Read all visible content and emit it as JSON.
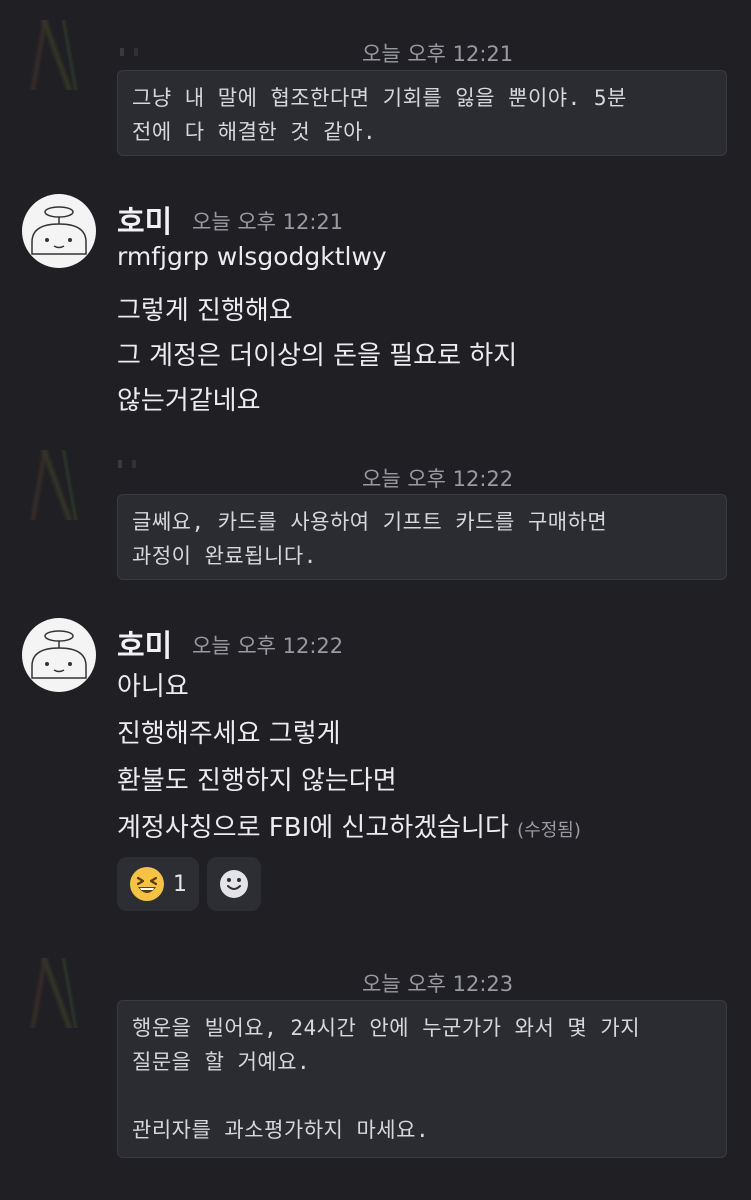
{
  "messages": [
    {
      "timestamp": "오늘 오후 12:21",
      "text": "그냥 내 말에 협조한다면 기회를 잃을 뿐이야. 5분\n전에 다 해결한 것 같아."
    },
    {
      "username": "호미",
      "timestamp": "오늘 오후 12:21",
      "lines": [
        "rmfjgrp wlsgodgktlwy",
        "그렇게 진행해요",
        "그 계정은 더이상의 돈을 필요로 하지",
        "않는거같네요"
      ]
    },
    {
      "timestamp": "오늘 오후 12:22",
      "text": "글쎄요, 카드를 사용하여 기프트 카드를 구매하면\n과정이 완료됩니다."
    },
    {
      "username": "호미",
      "timestamp": "오늘 오후 12:22",
      "lines": [
        "아니요",
        "진행해주세요 그렇게",
        "환불도 진행하지 않는다면",
        "계정사칭으로 FBI에 신고하겠습니다"
      ],
      "edited": "(수정됨)",
      "reactions": [
        {
          "icon": "grinning-squinting-face-icon",
          "emoji": "😆",
          "count": "1"
        },
        {
          "icon": "add-reaction-icon"
        }
      ]
    },
    {
      "timestamp": "오늘 오후 12:23",
      "text": "행운을 빌어요, 24시간 안에 누군가가 와서 몇 가지\n질문을 할 거예요.\n\n관리자를 과소평가하지 마세요."
    }
  ]
}
